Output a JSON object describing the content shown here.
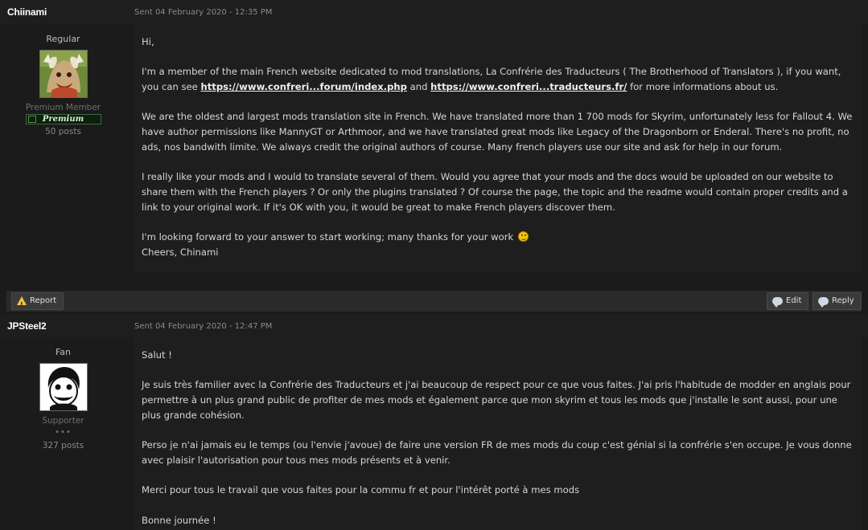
{
  "posts": [
    {
      "author": "Chiinami",
      "date": "Sent 04 February 2020 - 12:35 PM",
      "rank": "Regular",
      "member_type": "Premium Member",
      "badge": "Premium",
      "post_count": "50 posts",
      "avatar": "avatar-image",
      "message": {
        "greeting": "Hi,",
        "p1_a": "I'm a member of the main French website dedicated to mod translations, La Confrérie des Traducteurs ( The Brotherhood of Translators ), if you want, you can see ",
        "link1": "https://www.confreri...forum/index.php",
        "p1_b": " and ",
        "link2": "https://www.confreri...traducteurs.fr/",
        "p1_c": " for more informations about us.",
        "p2": "We are the oldest and largest mods translation site in French. We have translated more than 1 700 mods for Skyrim, unfortunately less for Fallout 4. We have author permissions like MannyGT or Arthmoor, and we have translated great mods like Legacy of the Dragonborn or Enderal. There's no profit, no ads, nos bandwith limite. We always credit the original authors of course. Many french players use our site and ask for help in our forum.",
        "p3": "I really like your mods and I would to translate several of them. Would you agree that your mods and the docs would be uploaded on our website to share them with the French players ? Or only the plugins translated ? Of course the page, the topic and the readme would contain proper credits and a link to your original work. If it's OK with you, it would be great to make French players discover them.",
        "p4": "I'm looking forward to your answer to start working; many thanks for your work",
        "sign": "Cheers, Chinami",
        "smiley": "wink-smiley-icon"
      }
    },
    {
      "author": "JPSteel2",
      "date": "Sent 04 February 2020 - 12:47 PM",
      "rank": "Fan",
      "member_type": "Supporter",
      "post_count": "327 posts",
      "dots": "•••",
      "avatar": "avatar-image",
      "message": {
        "p1": "Salut !",
        "p2": "Je suis très familier avec la Confrérie des Traducteurs et j'ai beaucoup de respect pour ce que vous faites. J'ai pris l'habitude de modder en anglais pour permettre à un plus grand public de profiter de mes mods et également parce que mon skyrim et tous les mods que j'installe le sont aussi, pour une plus grande cohésion.",
        "p3": "Perso je n'ai jamais eu le temps (ou l'envie j'avoue) de faire une version FR de mes mods du coup c'est génial si la confrérie s'en occupe. Je vous donne avec plaisir l'autorisation pour tous mes mods présents et à venir.",
        "p4": "Merci pour tous le travail que vous faites pour la commu fr et pour l'intérêt porté à mes mods",
        "p5": "Bonne journée !"
      }
    }
  ],
  "actions": {
    "report": "Report",
    "edit": "Edit",
    "reply": "Reply",
    "report_icon": "warning-icon",
    "edit_icon": "speech-bubble-icon",
    "reply_icon": "speech-bubble-icon"
  }
}
